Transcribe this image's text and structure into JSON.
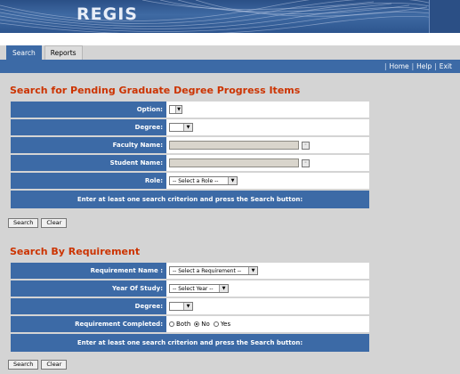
{
  "brand": {
    "logo_text": "REGIS"
  },
  "tabs": [
    {
      "label": "Search",
      "active": true
    },
    {
      "label": "Reports",
      "active": false
    }
  ],
  "nav": {
    "sep": "|",
    "links": [
      "Home",
      "Help",
      "Exit"
    ]
  },
  "section1": {
    "heading": "Search for Pending Graduate Degree Progress Items",
    "fields": {
      "option": {
        "label": "Option:",
        "value": ""
      },
      "degree": {
        "label": "Degree:",
        "value": ""
      },
      "faculty": {
        "label": "Faculty Name:",
        "value": ""
      },
      "student": {
        "label": "Student Name:",
        "value": ""
      },
      "role": {
        "label": "Role:",
        "value": "-- Select a Role --"
      }
    },
    "instruction": "Enter at least one search criterion and press the Search button:",
    "search_button": "Search",
    "clear_button": "Clear"
  },
  "section2": {
    "heading": "Search By Requirement",
    "fields": {
      "requirement_name": {
        "label": "Requirement Name :",
        "value": "-- Select a Requirement --"
      },
      "year_of_study": {
        "label": "Year Of Study:",
        "value": "-- Select Year --"
      },
      "degree": {
        "label": "Degree:",
        "value": ""
      },
      "completed": {
        "label": "Requirement Completed:",
        "options": [
          "Both",
          "No",
          "Yes"
        ],
        "selected": "No"
      }
    },
    "instruction": "Enter at least one search criterion and press the Search button:",
    "search_button": "Search",
    "clear_button": "Clear"
  },
  "colors": {
    "banner": "#2d558f",
    "bar": "#3c6aa6",
    "heading": "#cc3300",
    "page_bg": "#d4d4d4"
  }
}
